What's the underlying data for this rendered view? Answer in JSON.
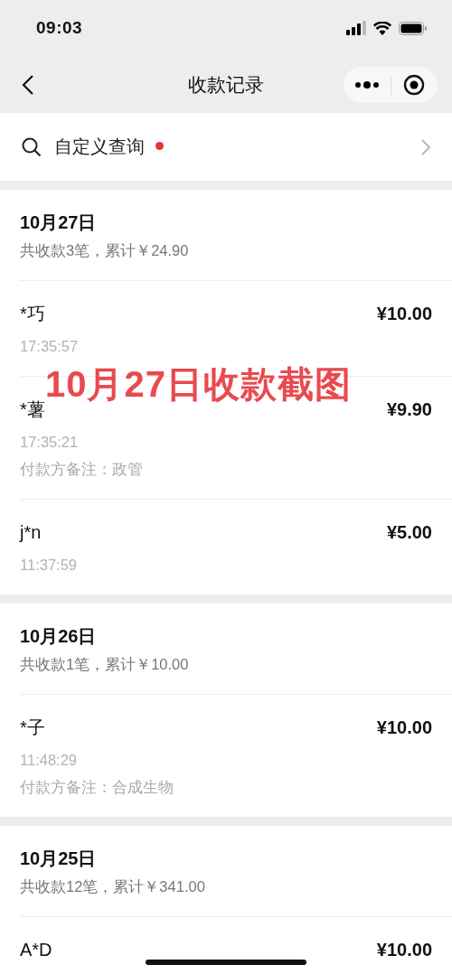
{
  "status_bar": {
    "time": "09:03"
  },
  "nav_bar": {
    "title": "收款记录"
  },
  "query": {
    "label": "自定义查询",
    "has_new": true
  },
  "groups": [
    {
      "date": "10月27日",
      "summary": "共收款3笔，累计￥24.90",
      "records": [
        {
          "name": "*巧",
          "amount": "¥10.00",
          "time": "17:35:57"
        },
        {
          "name": "*薯",
          "amount": "¥9.90",
          "time": "17:35:21",
          "note": "付款方备注：政管"
        },
        {
          "name": "j*n",
          "amount": "¥5.00",
          "time": "11:37:59"
        }
      ]
    },
    {
      "date": "10月26日",
      "summary": "共收款1笔，累计￥10.00",
      "records": [
        {
          "name": "*子",
          "amount": "¥10.00",
          "time": "11:48:29",
          "note": "付款方备注：合成生物"
        }
      ]
    },
    {
      "date": "10月25日",
      "summary": "共收款12笔，累计￥341.00",
      "records": [
        {
          "name": "A*D",
          "amount": "¥10.00"
        }
      ]
    }
  ],
  "annotation": {
    "text": "10月27日收款截图"
  }
}
